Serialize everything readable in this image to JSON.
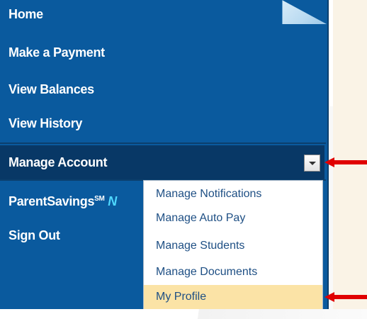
{
  "nav": {
    "items": [
      "Home",
      "Make a Payment",
      "View Balances",
      "View History"
    ],
    "active": "Manage Account",
    "parent_savings": "ParentSavings",
    "parent_savings_sup": "SM",
    "parent_savings_cut": "N",
    "sign_out": "Sign Out"
  },
  "dropdown_menu": {
    "items": [
      "Manage Notifications",
      "Manage Auto Pay",
      "Manage Students",
      "Manage Documents",
      "My Profile"
    ],
    "selected": "My Profile"
  },
  "colors": {
    "panel": "#0a5a9e",
    "active_item": "#083866",
    "menu_text": "#1e4f84",
    "highlight": "#fbe3a6",
    "arrow": "#e00000",
    "accent_cut": "#4fd8ff"
  }
}
